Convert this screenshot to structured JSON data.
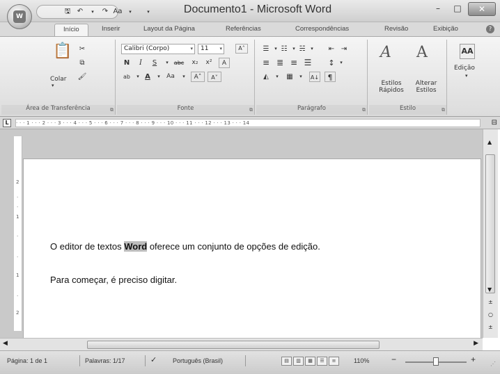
{
  "window": {
    "title": "Documento1 - Microsoft Word",
    "minimize": "–",
    "maximize": "□",
    "close": "✕"
  },
  "office_button": {
    "glyph": "W"
  },
  "quick_access": {
    "save": "🖫",
    "undo": "↶",
    "undo_drop": "▾",
    "redo": "↷",
    "font_case": "Aa",
    "font_case_drop": "▾",
    "customize": "▾"
  },
  "tabs": [
    "Início",
    "Inserir",
    "Layout da Página",
    "Referências",
    "Correspondências",
    "Revisão",
    "Exibição"
  ],
  "ribbon": {
    "clipboard": {
      "label": "Área de Transferência",
      "paste": "Colar",
      "cut": "✂",
      "copy": "⧉",
      "format_painter": "🖌"
    },
    "font": {
      "label": "Fonte",
      "font_name": "Calibri (Corpo)",
      "font_size": "11",
      "bold": "N",
      "italic": "I",
      "underline": "S",
      "strike": "abc",
      "subscript": "x₂",
      "superscript": "x²",
      "clear": "A",
      "highlight": "ab",
      "color": "A",
      "case": "Aa",
      "grow": "A˄",
      "shrink": "A˅"
    },
    "paragraph": {
      "label": "Parágrafo",
      "bullets": "☰",
      "numbering": "☷",
      "multilevel": "☵",
      "decrease_indent": "⇤",
      "increase_indent": "⇥",
      "align_left": "≡",
      "center": "≣",
      "align_right": "≡",
      "justify": "☰",
      "line_spacing": "↕",
      "shading": "◭",
      "borders": "▦",
      "sort": "A↓",
      "pilcrow": "¶"
    },
    "styles": {
      "label": "Estilo",
      "quick_styles": "Estilos Rápidos",
      "change_styles": "Alterar Estilos"
    },
    "editing": {
      "label": "Edição",
      "find": "AA"
    }
  },
  "ruler": {
    "numbers": "· · · 1 · · · 2 · · · 3 · · · 4 · · · 5 · · · 6 · · · 7 · · · 8 · · · 9 · · · 10 · · · 11 · · · 12 · · · 13 · · · 14"
  },
  "vruler": {
    "marks": [
      "2",
      "·",
      "·",
      "1",
      "·",
      "·",
      "1",
      "·",
      "2"
    ]
  },
  "document": {
    "line1_before": "O editor de textos ",
    "line1_highlight": "Word",
    "line1_after": " oferece um conjunto  de opções de edição.",
    "line2": "Para começar, é preciso digitar."
  },
  "status": {
    "page": "Página: 1 de 1",
    "words": "Palavras: 1/17",
    "language": "Português (Brasil)",
    "zoom": "110%",
    "zoom_minus": "−",
    "zoom_plus": "+",
    "zoom_level": 0.5
  }
}
